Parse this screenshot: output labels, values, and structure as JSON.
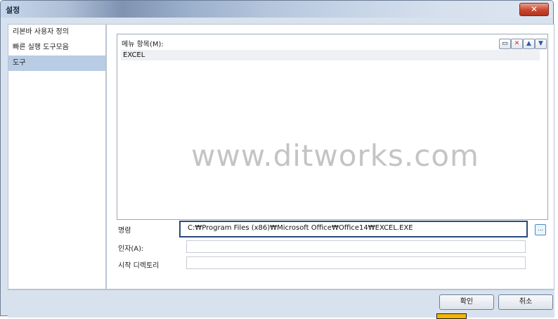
{
  "window": {
    "title": "설정",
    "close_glyph": "✕"
  },
  "sidebar": {
    "items": [
      {
        "label": "리본바 사용자 정의"
      },
      {
        "label": "빠른 실행 도구모음"
      },
      {
        "label": "도구",
        "selected": true
      }
    ]
  },
  "menu": {
    "label": "메뉴 항목(M):",
    "items": [
      "EXCEL"
    ],
    "toolbar": {
      "new_glyph": "▭",
      "delete_glyph": "✕",
      "up_glyph": "▲",
      "down_glyph": "▼"
    }
  },
  "watermark": "www.ditworks.com",
  "fields": {
    "command": {
      "label": "명령",
      "value": "C:₩Program Files (x86)₩Microsoft Office₩Office14₩EXCEL.EXE"
    },
    "arguments": {
      "label": "인자(A):",
      "value": ""
    },
    "start_dir": {
      "label": "시작 디렉토리",
      "value": ""
    },
    "browse_glyph": "..."
  },
  "buttons": {
    "ok": "확인",
    "cancel": "취소"
  },
  "colors": {
    "selection": "#b8cce4",
    "close": "#c9462f",
    "highlight_border": "#2a4a7c",
    "marker": "#f5b500"
  }
}
